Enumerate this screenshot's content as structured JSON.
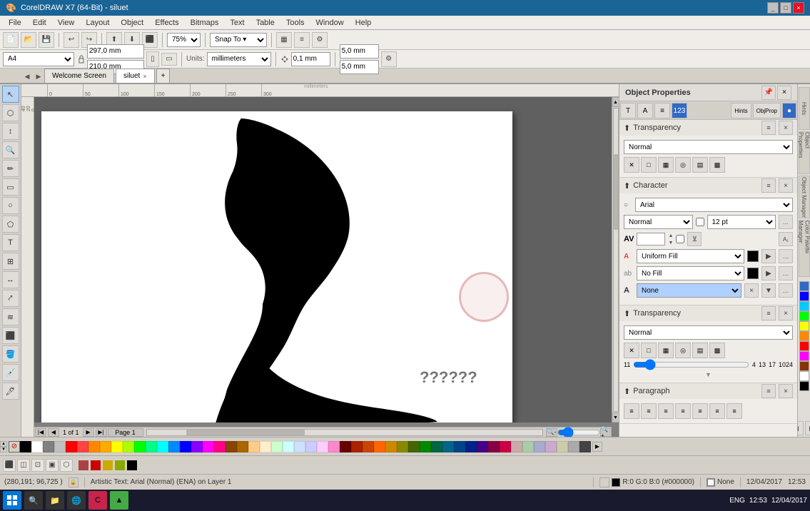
{
  "titleBar": {
    "title": "CorelDRAW X7 (64-Bit) - siluet",
    "controls": [
      "_",
      "□",
      "×"
    ]
  },
  "menuBar": {
    "items": [
      "File",
      "Edit",
      "View",
      "Layout",
      "Object",
      "Effects",
      "Bitmaps",
      "Text",
      "Table",
      "Tools",
      "Window",
      "Help"
    ]
  },
  "toolbar1": {
    "zoomLevel": "75%",
    "snapTo": "Snap To",
    "pageSize": "A4"
  },
  "toolbar2": {
    "width": "297,0 mm",
    "height": "210,0 mm",
    "units": "millimeters",
    "nudge": "0,1 mm",
    "duplicate": "5,0 mm",
    "duplicate2": "5,0 mm"
  },
  "tabs": {
    "items": [
      {
        "label": "Welcome Screen",
        "active": false
      },
      {
        "label": "siluet",
        "active": true
      }
    ],
    "addBtn": "+"
  },
  "canvas": {
    "questionMarks": "??????",
    "pageInfo": "1 of 1",
    "pageName": "Page 1",
    "rulerMarks": [
      "0",
      "50",
      "100",
      "150",
      "200",
      "250",
      "300"
    ]
  },
  "objectProperties": {
    "title": "Object Properties",
    "tabs": [
      "T",
      "A",
      "≡",
      "123",
      "fill",
      "stroke",
      "hints",
      "objprop",
      "color",
      "obj-mgr",
      "color-pal"
    ],
    "transparency": {
      "label": "Transparency",
      "mode": "Normal",
      "icons": [
        "×",
        "□",
        "▦",
        "▣",
        "▤",
        "▩"
      ],
      "sliderLabel": "Transparency"
    },
    "character": {
      "label": "Character",
      "font": "Arial",
      "style": "Normal",
      "size": "12 pt",
      "icons": [
        "Av",
        "A",
        "ab",
        "A"
      ],
      "fillType": "Uniform Fill",
      "fillColor": "#000000",
      "outlineType": "No Fill",
      "outlineColor": "#000000",
      "outlineNone": "None"
    },
    "transparency2": {
      "label": "Transparency",
      "mode": "Normal",
      "icons": [
        "×",
        "□",
        "▦",
        "▣",
        "▤",
        "▩"
      ],
      "sliderValues": [
        "11",
        "4",
        "13",
        "17",
        "1024"
      ]
    },
    "paragraph": {
      "label": "Paragraph",
      "alignIcons": [
        "≡←",
        "≡↔",
        "≡→",
        "≡|",
        "≡⊣",
        "≡⊢",
        "≡⊥"
      ]
    }
  },
  "statusBar": {
    "coords": "(280,191; 96,725 )",
    "layerInfo": "Artistic Text: Arial (Normal) (ENA) on Layer 1",
    "fill": "R:0 G:0 B:0 (#000000)",
    "outline": "None",
    "date": "12/04/2017",
    "time": "12:53",
    "pageIndicator": "1 of 1",
    "pageName": "Page 1"
  },
  "palette": {
    "colors": [
      "#000000",
      "#ffffff",
      "#808080",
      "#c0c0c0",
      "#ff0000",
      "#ff4444",
      "#ff8800",
      "#ffaa00",
      "#ffff00",
      "#aaff00",
      "#00ff00",
      "#00ff88",
      "#00ffff",
      "#0088ff",
      "#0000ff",
      "#8800ff",
      "#ff00ff",
      "#ff0088",
      "#884400",
      "#aa6600",
      "#ffcc88",
      "#ffeecc",
      "#ccffcc",
      "#ccffff",
      "#cce0ff",
      "#ccccff",
      "#ffccff",
      "#ff88cc",
      "#660000",
      "#aa2200",
      "#cc4400",
      "#ff6600",
      "#cc8800",
      "#888800",
      "#446600",
      "#008800",
      "#006644",
      "#006688",
      "#004488",
      "#002288",
      "#440088",
      "#880044",
      "#cc0044",
      "#ccaaaa",
      "#aaccaa",
      "#aaaacc",
      "#ccaacc",
      "#ccccaa",
      "#aaaaaa",
      "#444444"
    ]
  },
  "taskbar": {
    "startLabel": "Start",
    "time": "12:53",
    "date": "12/04/2017",
    "lang": "ENG"
  }
}
